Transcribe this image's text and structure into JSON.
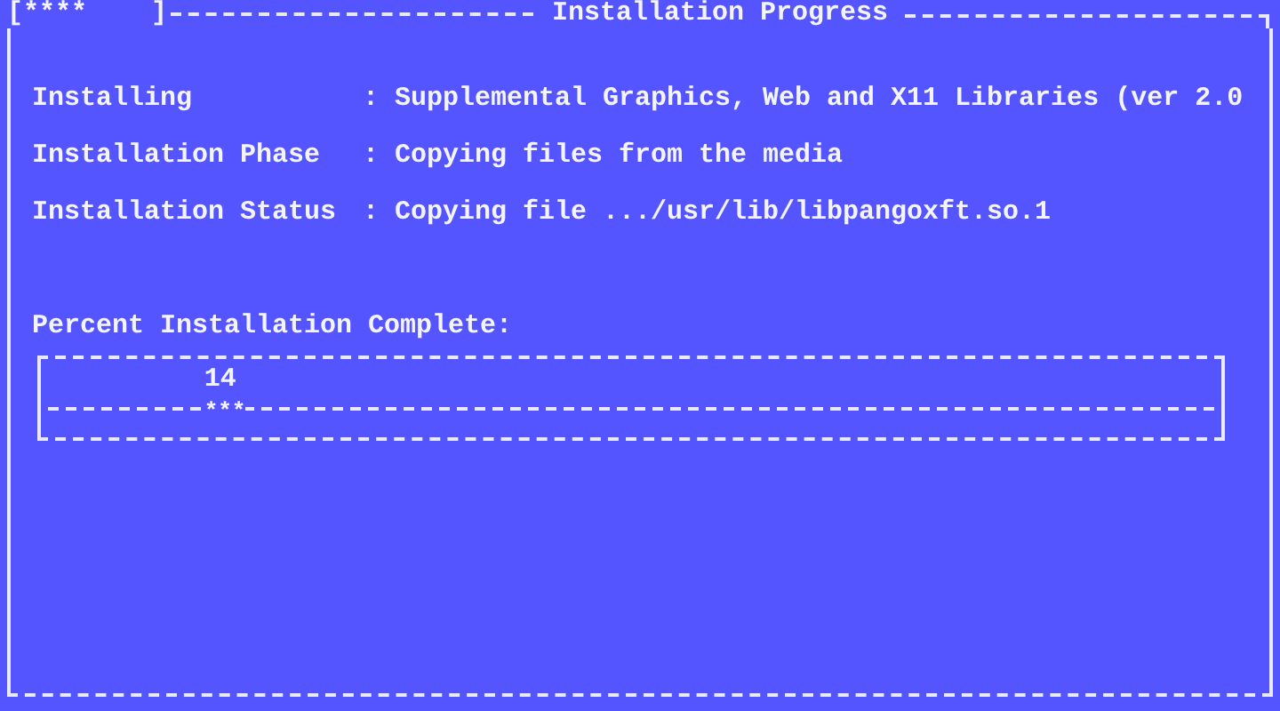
{
  "window": {
    "title": "Installation Progress",
    "spinner": "[****    ]"
  },
  "fields": [
    {
      "label": "Installing",
      "separator": ":",
      "value": "Supplemental Graphics, Web and X11 Libraries (ver 2.0"
    },
    {
      "label": "Installation Phase",
      "separator": ":",
      "value": "Copying files from the media"
    },
    {
      "label": "Installation Status",
      "separator": ":",
      "value": "Copying file .../usr/lib/libpangoxft.so.1"
    }
  ],
  "progress": {
    "label": "Percent Installation Complete:",
    "percent": "14",
    "marker": "***",
    "level": 0.14
  }
}
